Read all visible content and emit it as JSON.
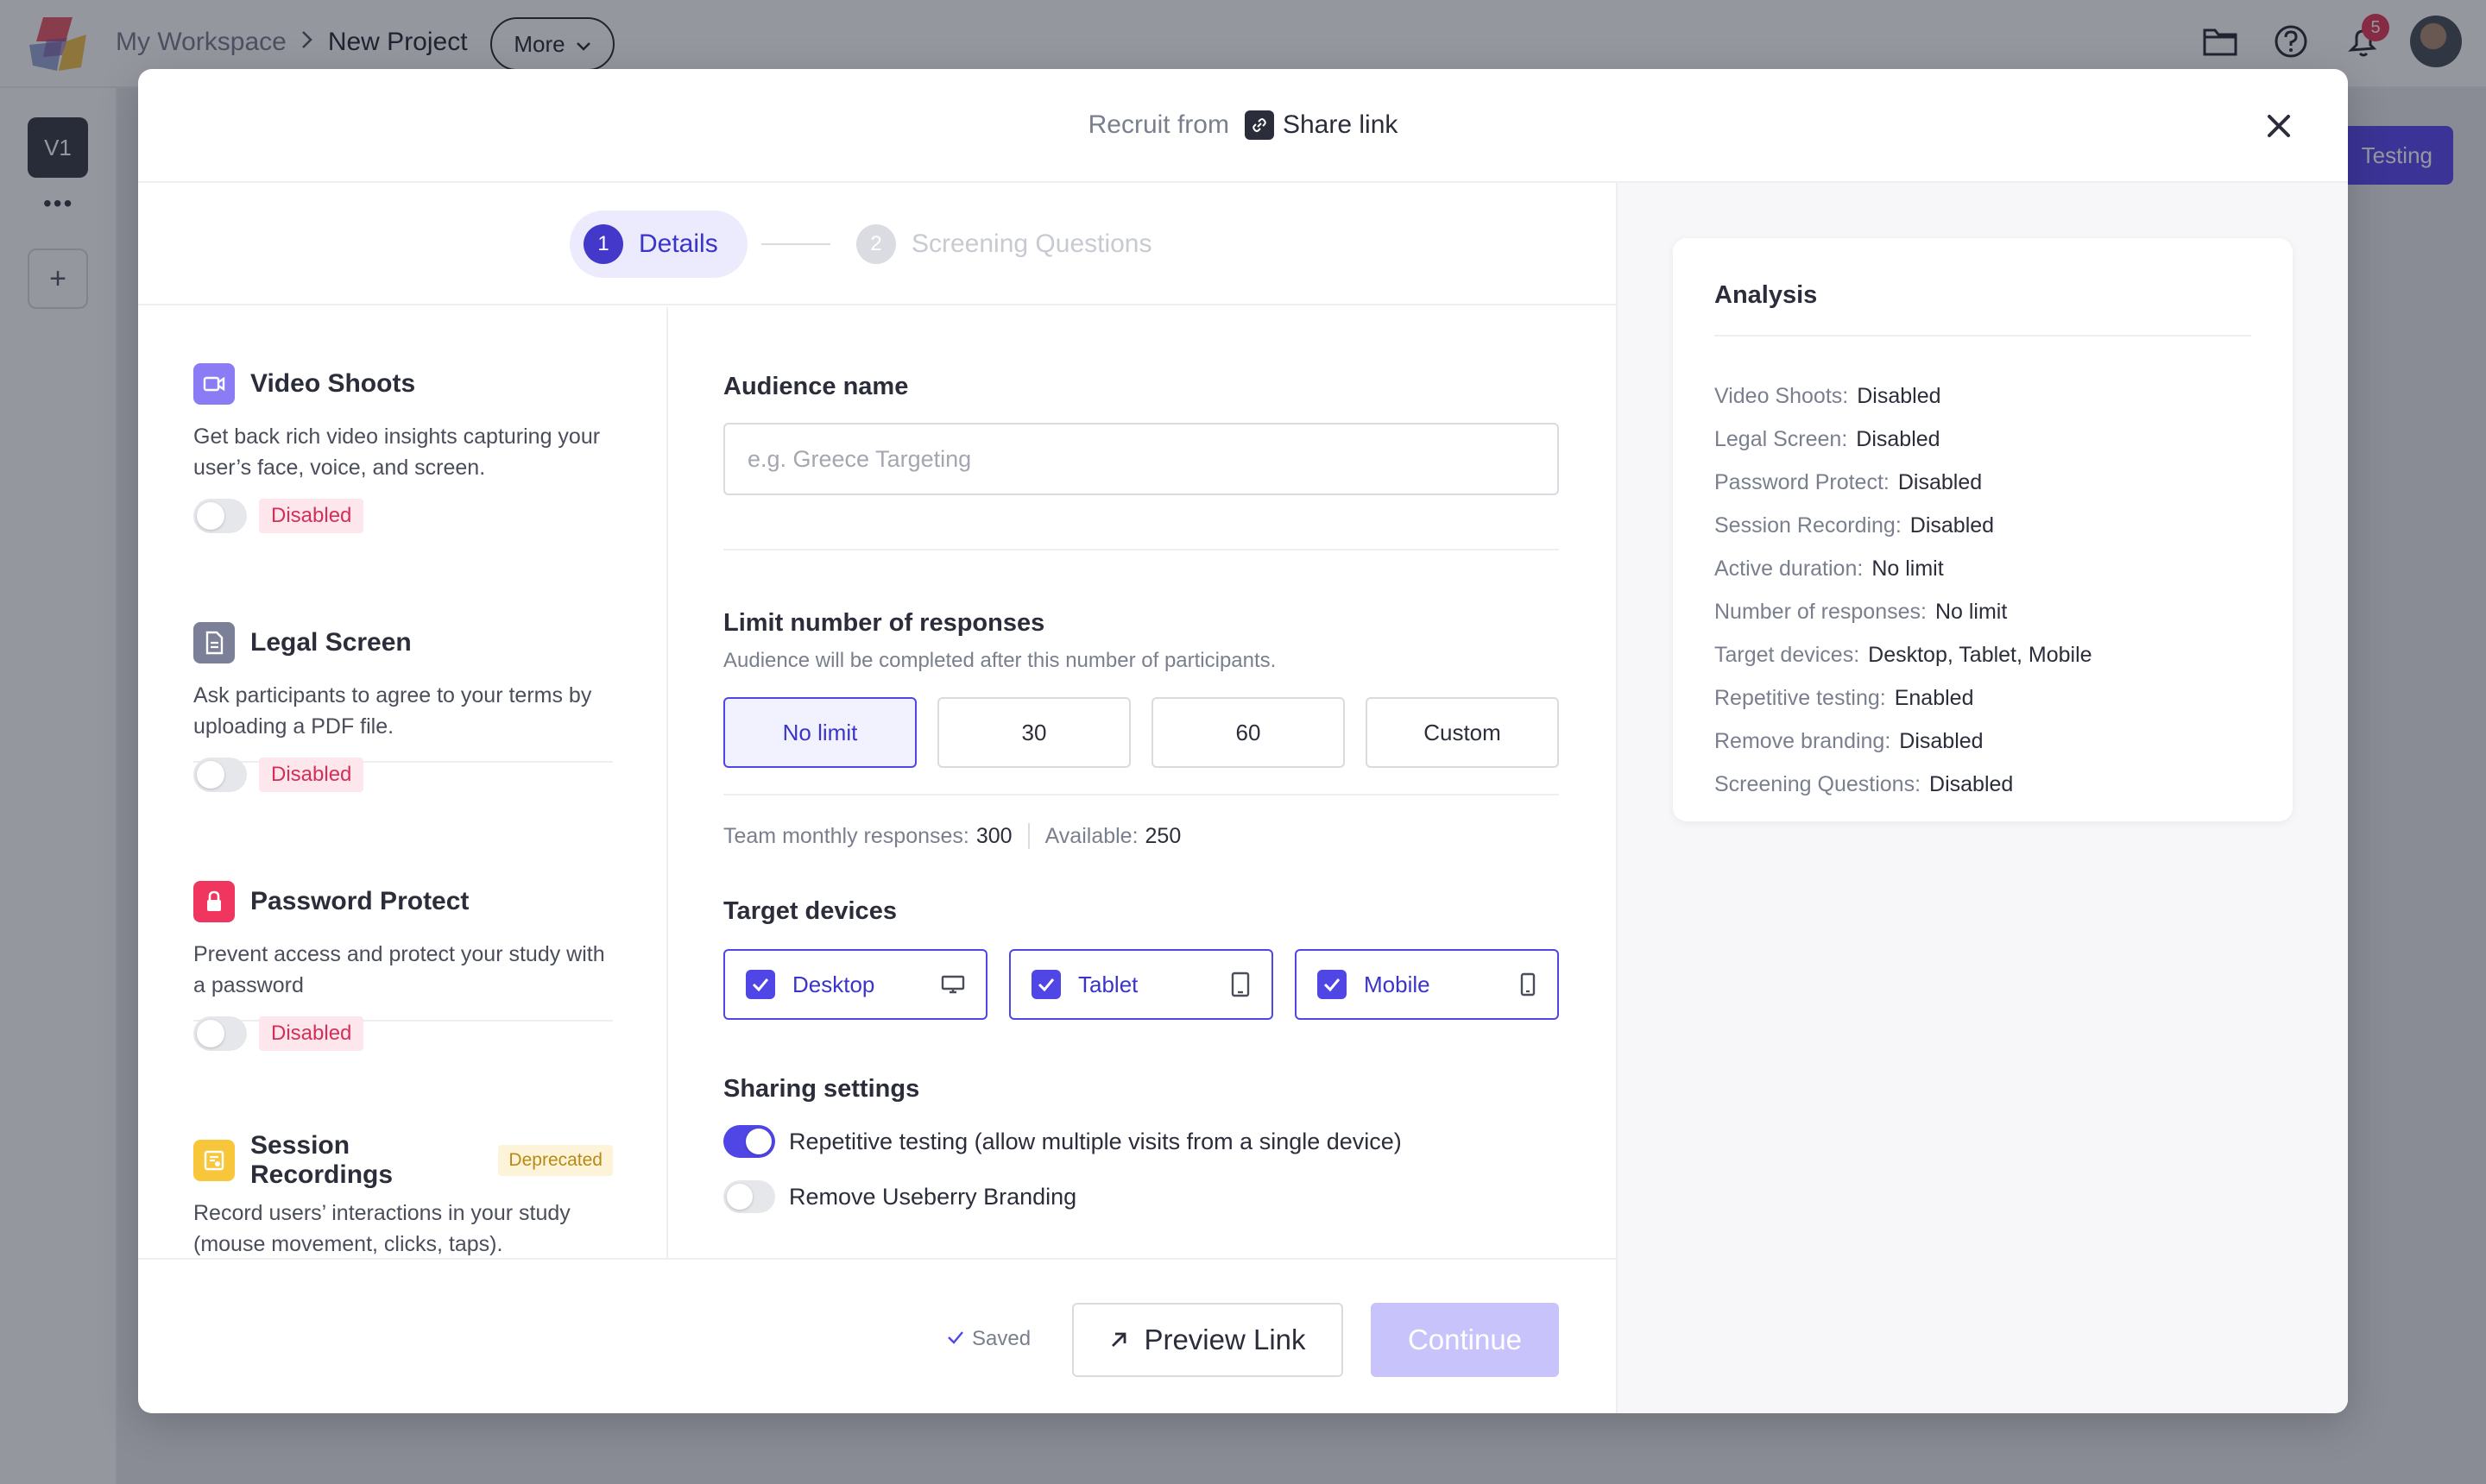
{
  "app": {
    "breadcrumb": {
      "workspace": "My Workspace",
      "project": "New Project"
    },
    "more_label": "More",
    "notifications_count": "5",
    "version_label": "V1",
    "rail_more": "•••",
    "rail_add": "+",
    "testing_label": "Testing"
  },
  "modal": {
    "recruit_label": "Recruit from",
    "share_label": "Share link",
    "steps": [
      {
        "num": "1",
        "label": "Details"
      },
      {
        "num": "2",
        "label": "Screening Questions"
      }
    ]
  },
  "features": [
    {
      "title": "Video Shoots",
      "desc": "Get back rich video insights capturing your user’s face, voice, and screen.",
      "status": "Disabled"
    },
    {
      "title": "Legal Screen",
      "desc": "Ask participants to agree to your terms by uploading a PDF file.",
      "status": "Disabled"
    },
    {
      "title": "Password Protect",
      "desc": "Prevent access and protect your study with a password",
      "status": "Disabled"
    },
    {
      "title": "Session Recordings",
      "badge": "Deprecated",
      "desc": "Record users’ interactions in your study (mouse movement, clicks, taps)."
    }
  ],
  "form": {
    "audience_label": "Audience name",
    "audience_placeholder": "e.g. Greece Targeting",
    "limit_label": "Limit number of responses",
    "limit_hint": "Audience will be completed after this number of participants.",
    "limit_options": [
      "No limit",
      "30",
      "60",
      "Custom"
    ],
    "team_label": "Team monthly responses:",
    "team_value": "300",
    "available_label": "Available:",
    "available_value": "250",
    "devices_label": "Target devices",
    "devices": [
      "Desktop",
      "Tablet",
      "Mobile"
    ],
    "sharing_label": "Sharing settings",
    "sharing": [
      {
        "label": "Repetitive testing (allow multiple visits from a single device)",
        "on": true
      },
      {
        "label": "Remove Useberry Branding",
        "on": false
      }
    ]
  },
  "footer": {
    "saved": "Saved",
    "preview": "Preview Link",
    "continue": "Continue"
  },
  "analysis": {
    "title": "Analysis",
    "rows": [
      {
        "key": "Video Shoots:",
        "value": "Disabled"
      },
      {
        "key": "Legal Screen:",
        "value": "Disabled"
      },
      {
        "key": "Password Protect:",
        "value": "Disabled"
      },
      {
        "key": "Session Recording:",
        "value": "Disabled"
      },
      {
        "key": "Active duration:",
        "value": "No limit"
      },
      {
        "key": "Number of responses:",
        "value": "No limit"
      },
      {
        "key": "Target devices:",
        "value": "Desktop, Tablet, Mobile"
      },
      {
        "key": "Repetitive testing:",
        "value": "Enabled"
      },
      {
        "key": "Remove branding:",
        "value": "Disabled"
      },
      {
        "key": "Screening Questions:",
        "value": "Disabled"
      }
    ]
  },
  "colors": {
    "accent": "#4f46e5",
    "disabled_badge": "#d32f58",
    "deprecated_badge": "#b88a12"
  }
}
